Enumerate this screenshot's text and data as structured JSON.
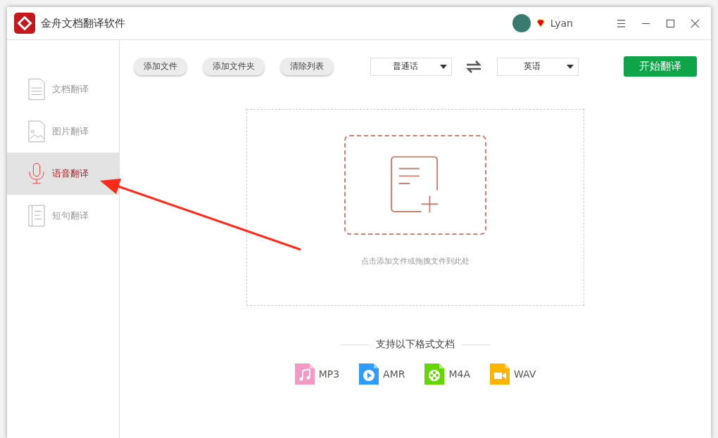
{
  "window": {
    "title": "金舟文档翻译软件",
    "user": "Lyan"
  },
  "sidebar": {
    "items": [
      {
        "label": "文档翻译",
        "kind": "document",
        "selected": false
      },
      {
        "label": "图片翻译",
        "kind": "image",
        "selected": false
      },
      {
        "label": "语音翻译",
        "kind": "microphone",
        "selected": true
      },
      {
        "label": "短句翻译",
        "kind": "sentence",
        "selected": false
      }
    ]
  },
  "toolbar": {
    "buttons": [
      "添加文件",
      "添加文件夹",
      "清除列表"
    ],
    "source_language": "普通话",
    "target_language": "英语",
    "start_button": "开始翻译"
  },
  "drop_zone": {
    "hint": "点击添加文件或拖拽文件到此处"
  },
  "formats": {
    "title": "支持以下格式文档",
    "items": [
      {
        "label": "MP3",
        "kind": "music",
        "color": "#f598c4"
      },
      {
        "label": "AMR",
        "kind": "play",
        "color": "#2e9bff"
      },
      {
        "label": "M4A",
        "kind": "reel",
        "color": "#66d600"
      },
      {
        "label": "WAV",
        "kind": "video",
        "color": "#ffb400"
      }
    ]
  },
  "annotation": {
    "kind": "arrow"
  }
}
